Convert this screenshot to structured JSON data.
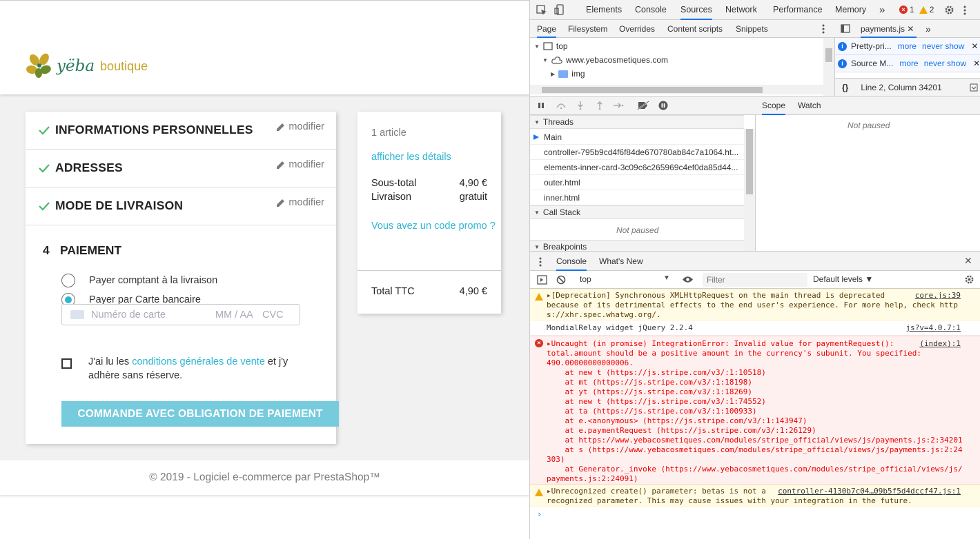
{
  "shop": {
    "logo_text": "yëba",
    "logo_text2": "boutique",
    "steps": [
      {
        "title": "INFORMATIONS PERSONNELLES",
        "modify": "modifier"
      },
      {
        "title": "ADRESSES",
        "modify": "modifier"
      },
      {
        "title": "MODE DE LIVRAISON",
        "modify": "modifier"
      }
    ],
    "payment": {
      "number": "4",
      "title": "PAIEMENT",
      "option_cash": "Payer comptant à la livraison",
      "option_card": "Payer par Carte bancaire",
      "card_placeholder": "Numéro de carte",
      "exp_placeholder": "MM / AA",
      "cvc_placeholder": "CVC",
      "terms_pre": "J'ai lu les ",
      "terms_link": "conditions générales de vente",
      "terms_post": " et j'y adhère sans réserve.",
      "order_button": "COMMANDE AVEC OBLIGATION DE PAIEMENT"
    },
    "summary": {
      "count": "1 article",
      "details_link": "afficher les détails",
      "subtotal_label": "Sous-total",
      "subtotal_value": "4,90 €",
      "shipping_label": "Livraison",
      "shipping_value": "gratuit",
      "promo_link": "Vous avez un code promo ?",
      "total_label": "Total TTC",
      "total_value": "4,90 €"
    },
    "footer": "© 2019 - Logiciel e-commerce par PrestaShop™"
  },
  "devtools": {
    "tabs": [
      "Elements",
      "Console",
      "Sources",
      "Network",
      "Performance",
      "Memory"
    ],
    "more_tabs": "»",
    "error_count": "1",
    "warning_count": "2",
    "nav_tabs": [
      "Page",
      "Filesystem",
      "Overrides",
      "Content scripts",
      "Snippets"
    ],
    "tree": {
      "top": "top",
      "domain": "www.yebacosmetiques.com",
      "folder": "img"
    },
    "editor_tab": "payments.js",
    "infobar1": {
      "text": "Pretty-pri...",
      "more": "more",
      "never": "never show"
    },
    "infobar2": {
      "text": "Source M...",
      "more": "more",
      "never": "never show"
    },
    "status": "Line 2, Column 34201",
    "threads_header": "Threads",
    "threads": [
      "Main",
      "controller-795b9cd4f6f84de670780ab84c7a1064.ht...",
      "elements-inner-card-3c09c6c265969c4ef0da85d44...",
      "outer.html",
      "inner.html"
    ],
    "call_stack_header": "Call Stack",
    "not_paused": "Not paused",
    "breakpoints_header": "Breakpoints",
    "scope_tabs": [
      "Scope",
      "Watch"
    ],
    "drawer_tabs": [
      "Console",
      "What's New"
    ],
    "context": "top",
    "filter_placeholder": "Filter",
    "levels": "Default levels ▼",
    "messages": {
      "m1_body": "▸[Deprecation] Synchronous XMLHttpRequest on the main thread is deprecated\nbecause of its detrimental effects to the end user's experience. For more help, check http\ns://xhr.spec.whatwg.org/.",
      "m1_src": "core.js:39",
      "m2_body": "MondialRelay widget jQuery 2.2.4",
      "m2_src": "js?v=4.0.7:1",
      "m3_body": "▸Uncaught (in promise) IntegrationError: Invalid value for paymentRequest():\ntotal.amount should be a positive amount in the currency's subunit. You specified:\n490.00000000000006.\n    at new t (https://js.stripe.com/v3/:1:10518)\n    at mt (https://js.stripe.com/v3/:1:18198)\n    at yt (https://js.stripe.com/v3/:1:18269)\n    at new t (https://js.stripe.com/v3/:1:74552)\n    at ta (https://js.stripe.com/v3/:1:100933)\n    at e.<anonymous> (https://js.stripe.com/v3/:1:143947)\n    at e.paymentRequest (https://js.stripe.com/v3/:1:26129)\n    at https://www.yebacosmetiques.com/modules/stripe_official/views/js/payments.js:2:34201\n    at s (https://www.yebacosmetiques.com/modules/stripe_official/views/js/payments.js:2:24\n303)\n    at Generator._invoke (https://www.yebacosmetiques.com/modules/stripe_official/views/js/\npayments.js:2:24091)",
      "m3_src": "(index):1",
      "m4_body": "▸Unrecognized create() parameter: betas is not a\nrecognized parameter. This may cause issues with your integration in the future.",
      "m4_src": "controller-4130b7c04…09b5f5d4dccf47.js:1"
    },
    "prompt": "›"
  }
}
